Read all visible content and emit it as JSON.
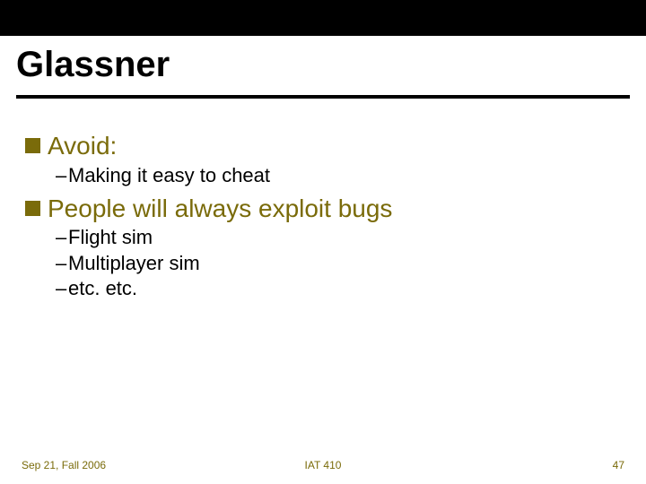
{
  "title": "Glassner",
  "bullets": [
    {
      "level": 1,
      "text": "Avoid:",
      "sub": [
        "Making it easy to cheat"
      ]
    },
    {
      "level": 1,
      "text": "People will always exploit bugs",
      "sub": [
        "Flight sim",
        "Multiplayer sim",
        "etc. etc."
      ]
    }
  ],
  "footer": {
    "left": "Sep 21, Fall 2006",
    "center": "IAT 410",
    "right": "47"
  }
}
